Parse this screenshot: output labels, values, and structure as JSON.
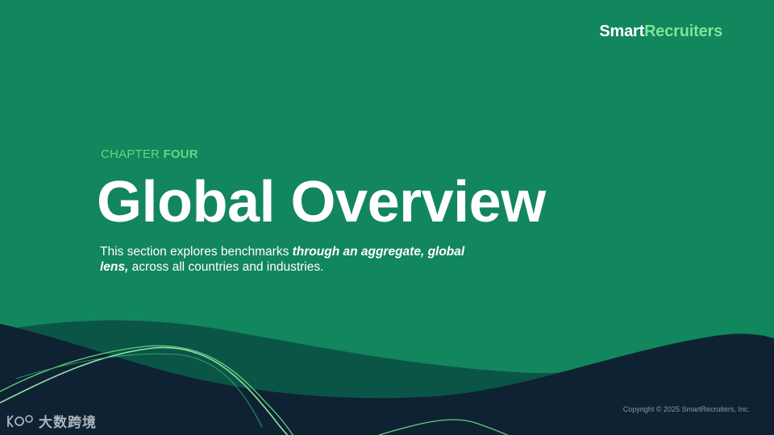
{
  "brand": {
    "name_part1": "Smart",
    "name_part2": "Recruiters"
  },
  "chapter": {
    "label": "CHAPTER ",
    "number": "FOUR"
  },
  "title": "Global Overview",
  "description": {
    "part1": "This section explores benchmarks ",
    "emphasis": "through an aggregate, global lens,",
    "part2": " across all countries and industries."
  },
  "footer": {
    "copyright": "Copyright © 2025 SmartRecruiters, Inc."
  },
  "watermark": {
    "text": "大数跨境"
  },
  "colors": {
    "background": "#12865c",
    "wave_dark": "#0f2233",
    "wave_mid": "#0a5546",
    "accent": "#7fe39a"
  }
}
